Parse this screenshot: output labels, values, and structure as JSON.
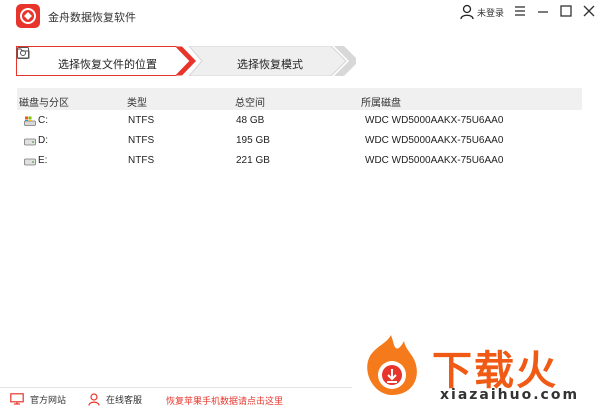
{
  "window": {
    "title": "金舟数据恢复软件",
    "login_label": "未登录"
  },
  "steps": [
    {
      "label": "选择恢复文件的位置",
      "active": true
    },
    {
      "label": "选择恢复模式",
      "active": false
    }
  ],
  "table": {
    "headers": [
      "磁盘与分区",
      "类型",
      "总空间",
      "所属磁盘"
    ],
    "rows": [
      {
        "drive": "C:",
        "type": "NTFS",
        "size": "48 GB",
        "disk": "WDC WD5000AAKX-75U6AA0",
        "icon": "system-drive-icon"
      },
      {
        "drive": "D:",
        "type": "NTFS",
        "size": "195 GB",
        "disk": "WDC WD5000AAKX-75U6AA0",
        "icon": "hard-drive-icon"
      },
      {
        "drive": "E:",
        "type": "NTFS",
        "size": "221 GB",
        "disk": "WDC WD5000AAKX-75U6AA0",
        "icon": "hard-drive-icon"
      }
    ]
  },
  "footer": {
    "website_label": "官方网站",
    "support_label": "在线客服",
    "mobile_recovery_link": "恢复苹果手机数据请点击这里"
  },
  "watermark": {
    "text": "下载火",
    "url": "xiazaihuo.com"
  },
  "colors": {
    "accent": "#e8352c",
    "watermark": "#f05a14"
  }
}
